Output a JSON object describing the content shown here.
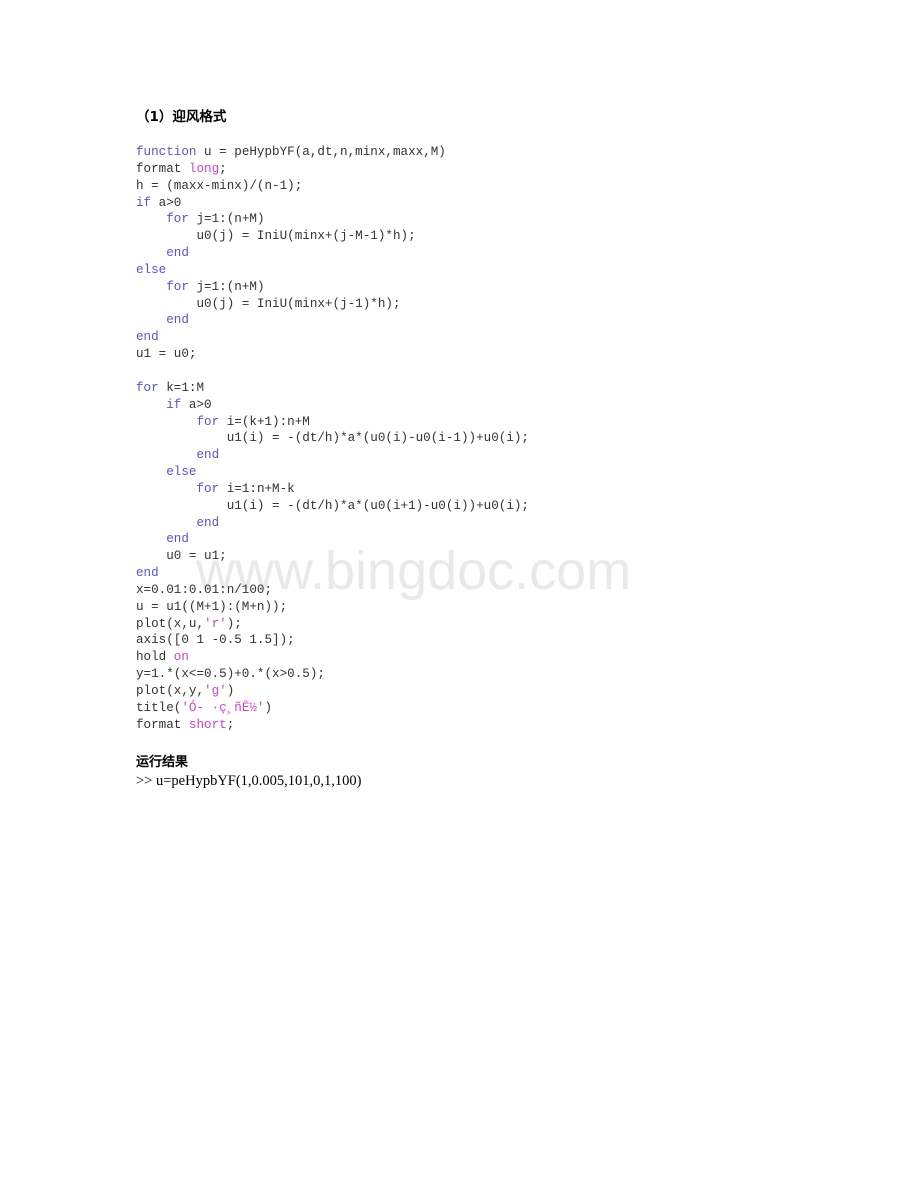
{
  "document": {
    "heading": "（1）迎风格式",
    "watermark": "www.bingdoc.com"
  },
  "code": {
    "language": "matlab",
    "colors": {
      "keyword": "#5555cc",
      "string": "#cc44cc",
      "plain": "#333333"
    },
    "lines": [
      [
        {
          "t": "function",
          "c": "kw"
        },
        {
          "t": " u = peHypbYF(a,dt,n,minx,maxx,M)",
          "c": "plain"
        }
      ],
      [
        {
          "t": "format ",
          "c": "plain"
        },
        {
          "t": "long",
          "c": "str"
        },
        {
          "t": ";",
          "c": "plain"
        }
      ],
      [
        {
          "t": "h = (maxx-minx)/(n-1);",
          "c": "plain"
        }
      ],
      [
        {
          "t": "if",
          "c": "kw"
        },
        {
          "t": " a>0",
          "c": "plain"
        }
      ],
      [
        {
          "t": "    ",
          "c": "plain"
        },
        {
          "t": "for",
          "c": "kw"
        },
        {
          "t": " j=1:(n+M)",
          "c": "plain"
        }
      ],
      [
        {
          "t": "        u0(j) = IniU(minx+(j-M-1)*h);",
          "c": "plain"
        }
      ],
      [
        {
          "t": "    ",
          "c": "plain"
        },
        {
          "t": "end",
          "c": "kw"
        }
      ],
      [
        {
          "t": "else",
          "c": "kw"
        }
      ],
      [
        {
          "t": "    ",
          "c": "plain"
        },
        {
          "t": "for",
          "c": "kw"
        },
        {
          "t": " j=1:(n+M)",
          "c": "plain"
        }
      ],
      [
        {
          "t": "        u0(j) = IniU(minx+(j-1)*h);",
          "c": "plain"
        }
      ],
      [
        {
          "t": "    ",
          "c": "plain"
        },
        {
          "t": "end",
          "c": "kw"
        }
      ],
      [
        {
          "t": "end",
          "c": "kw"
        }
      ],
      [
        {
          "t": "u1 = u0;",
          "c": "plain"
        }
      ],
      [
        {
          "t": "",
          "c": "plain"
        }
      ],
      [
        {
          "t": "for",
          "c": "kw"
        },
        {
          "t": " k=1:M",
          "c": "plain"
        }
      ],
      [
        {
          "t": "    ",
          "c": "plain"
        },
        {
          "t": "if",
          "c": "kw"
        },
        {
          "t": " a>0",
          "c": "plain"
        }
      ],
      [
        {
          "t": "        ",
          "c": "plain"
        },
        {
          "t": "for",
          "c": "kw"
        },
        {
          "t": " i=(k+1):n+M",
          "c": "plain"
        }
      ],
      [
        {
          "t": "            u1(i) = -(dt/h)*a*(u0(i)-u0(i-1))+u0(i);",
          "c": "plain"
        }
      ],
      [
        {
          "t": "        ",
          "c": "plain"
        },
        {
          "t": "end",
          "c": "kw"
        }
      ],
      [
        {
          "t": "    ",
          "c": "plain"
        },
        {
          "t": "else",
          "c": "kw"
        }
      ],
      [
        {
          "t": "        ",
          "c": "plain"
        },
        {
          "t": "for",
          "c": "kw"
        },
        {
          "t": " i=1:n+M-k",
          "c": "plain"
        }
      ],
      [
        {
          "t": "            u1(i) = -(dt/h)*a*(u0(i+1)-u0(i))+u0(i);",
          "c": "plain"
        }
      ],
      [
        {
          "t": "        ",
          "c": "plain"
        },
        {
          "t": "end",
          "c": "kw"
        }
      ],
      [
        {
          "t": "    ",
          "c": "plain"
        },
        {
          "t": "end",
          "c": "kw"
        }
      ],
      [
        {
          "t": "    u0 = u1;",
          "c": "plain"
        }
      ],
      [
        {
          "t": "end",
          "c": "kw"
        }
      ],
      [
        {
          "t": "x=0.01:0.01:n/100;",
          "c": "plain"
        }
      ],
      [
        {
          "t": "u = u1((M+1):(M+n));",
          "c": "plain"
        }
      ],
      [
        {
          "t": "plot(x,u,",
          "c": "plain"
        },
        {
          "t": "'r'",
          "c": "str"
        },
        {
          "t": ");",
          "c": "plain"
        }
      ],
      [
        {
          "t": "axis([0 1 -0.5 1.5]);",
          "c": "plain"
        }
      ],
      [
        {
          "t": "hold ",
          "c": "plain"
        },
        {
          "t": "on",
          "c": "str"
        }
      ],
      [
        {
          "t": "y=1.*(x<=0.5)+0.*(x>0.5);",
          "c": "plain"
        }
      ],
      [
        {
          "t": "plot(x,y,",
          "c": "plain"
        },
        {
          "t": "'g'",
          "c": "str"
        },
        {
          "t": ")",
          "c": "plain"
        }
      ],
      [
        {
          "t": "title(",
          "c": "plain"
        },
        {
          "t": "'Ó- ·ç¸ñÊ½'",
          "c": "str"
        },
        {
          "t": ")",
          "c": "plain"
        }
      ],
      [
        {
          "t": "format ",
          "c": "plain"
        },
        {
          "t": "short",
          "c": "str"
        },
        {
          "t": ";",
          "c": "plain"
        }
      ]
    ]
  },
  "results": {
    "heading": "运行结果",
    "command": ">> u=peHypbYF(1,0.005,101,0,1,100)"
  }
}
